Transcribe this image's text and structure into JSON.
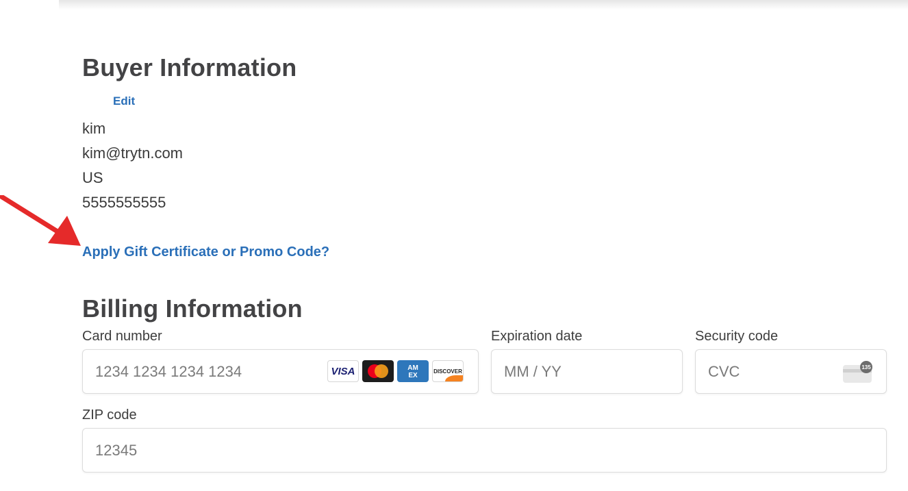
{
  "buyer": {
    "title": "Buyer Information",
    "edit_label": "Edit",
    "name": "kim",
    "email": "kim@trytn.com",
    "country": "US",
    "phone": "5555555555"
  },
  "promo": {
    "link_label": "Apply Gift Certificate or Promo Code?"
  },
  "billing": {
    "title": "Billing Information",
    "card_number": {
      "label": "Card number",
      "placeholder": "1234 1234 1234 1234",
      "brands": [
        "VISA",
        "Mastercard",
        "AMEX",
        "DISCOVER"
      ]
    },
    "expiration": {
      "label": "Expiration date",
      "placeholder": "MM / YY"
    },
    "security_code": {
      "label": "Security code",
      "placeholder": "CVC",
      "icon_badge": "135"
    },
    "zip": {
      "label": "ZIP code",
      "placeholder": "12345"
    }
  },
  "annotation": {
    "arrow_color": "#e53030"
  },
  "colors": {
    "link": "#2a6fb8",
    "heading": "#434345"
  }
}
